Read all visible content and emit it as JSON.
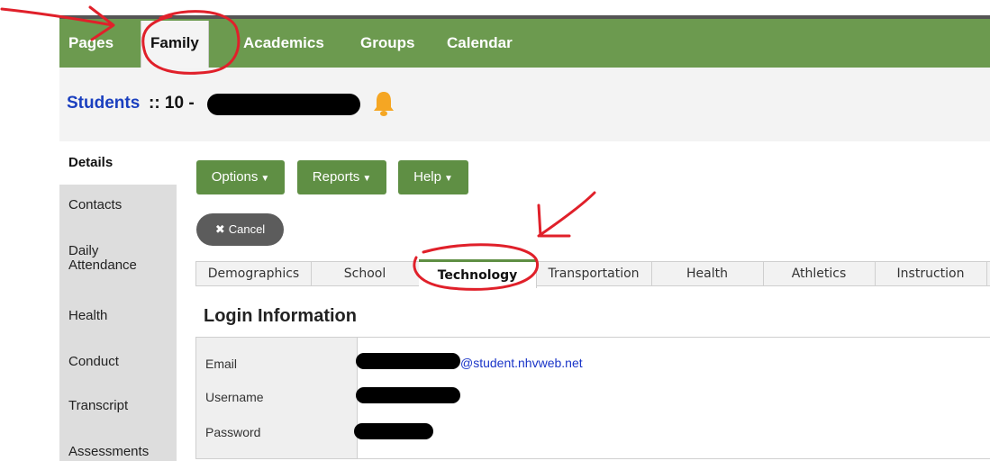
{
  "nav": {
    "items": [
      {
        "label": "Pages"
      },
      {
        "label": "Family"
      },
      {
        "label": "Academics"
      },
      {
        "label": "Groups"
      },
      {
        "label": "Calendar"
      }
    ],
    "active": "Family"
  },
  "header": {
    "breadcrumb_link": "Students",
    "breadcrumb_rest": ":: 10 -"
  },
  "sidebar": {
    "items": [
      {
        "label": "Details"
      },
      {
        "label": "Contacts"
      },
      {
        "label": "Daily"
      },
      {
        "label": "Attendance"
      },
      {
        "label": "Health"
      },
      {
        "label": "Conduct"
      },
      {
        "label": "Transcript"
      },
      {
        "label": "Assessments"
      }
    ],
    "active": "Details"
  },
  "toolbar": {
    "options_label": "Options",
    "reports_label": "Reports",
    "help_label": "Help",
    "cancel_label": "Cancel"
  },
  "tabs": {
    "items": [
      {
        "label": "Demographics"
      },
      {
        "label": "School"
      },
      {
        "label": "Technology"
      },
      {
        "label": "Transportation"
      },
      {
        "label": "Health"
      },
      {
        "label": "Athletics"
      },
      {
        "label": "Instruction"
      }
    ],
    "active": "Technology"
  },
  "login": {
    "title": "Login Information",
    "email_label": "Email",
    "username_label": "Username",
    "password_label": "Password",
    "email_domain": "@student.nhvweb.net"
  },
  "colors": {
    "nav_green": "#6c9a4f",
    "button_green": "#5f8f44",
    "link_blue": "#1a3fbf",
    "annotation_red": "#e0202a",
    "bell_orange": "#f5a623"
  },
  "icons": {
    "bell": "bell-icon",
    "cancel": "close-icon",
    "caret": "caret-down-icon"
  }
}
